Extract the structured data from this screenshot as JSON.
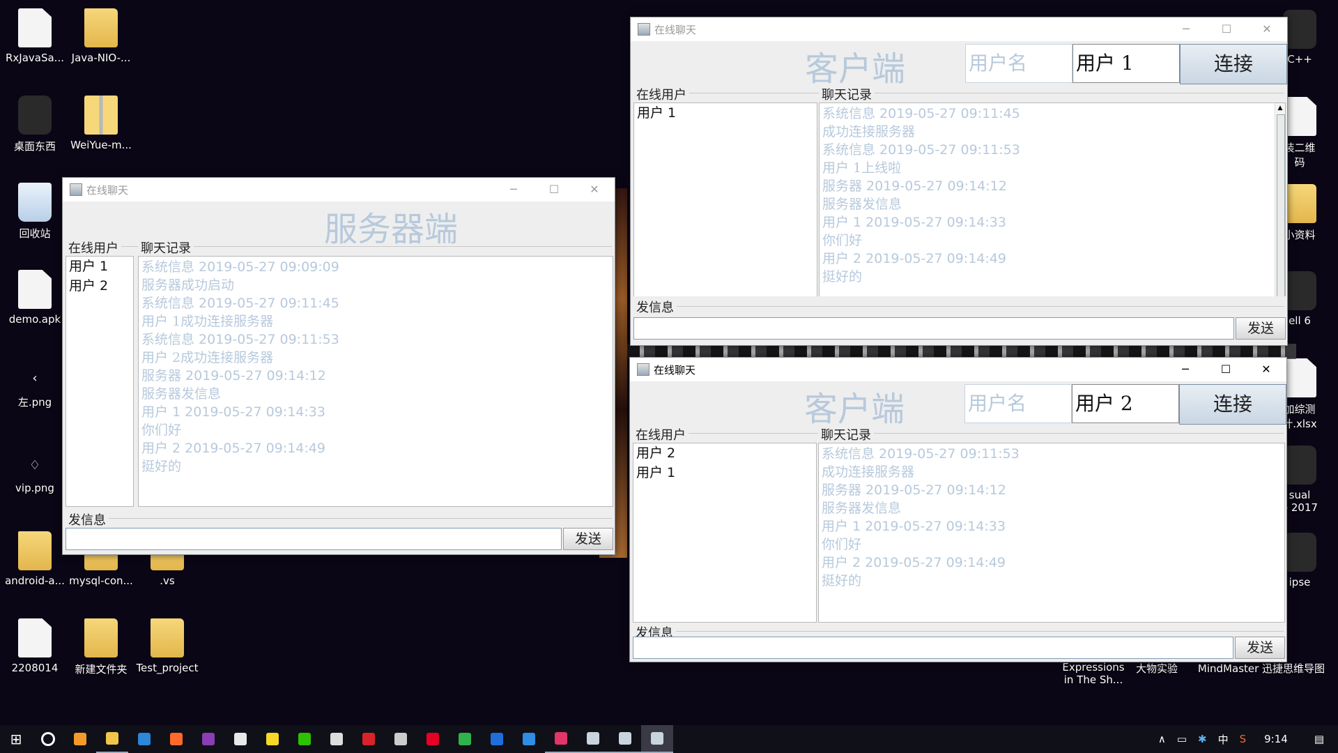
{
  "desktop": {
    "icons_left": [
      {
        "label": "RxJavaSa...",
        "type": "file"
      },
      {
        "label": "Java-NIO-...",
        "type": "folder"
      },
      {
        "label": "桌面东西",
        "type": "app"
      },
      {
        "label": "WeiYue-m...",
        "type": "zip"
      },
      {
        "label": "回收站",
        "type": "bin"
      },
      {
        "label": "demo.apk",
        "type": "file"
      },
      {
        "label": "左.png",
        "type": "small",
        "glyph": "‹"
      },
      {
        "label": "vip.png",
        "type": "small",
        "glyph": "♢"
      },
      {
        "label": "android-a...",
        "type": "folder"
      },
      {
        "label": "mysql-con...",
        "type": "folder"
      },
      {
        "label": ".vs",
        "type": "folder"
      },
      {
        "label": "2208014",
        "type": "file"
      },
      {
        "label": "新建文件夹",
        "type": "folder"
      },
      {
        "label": "Test_project",
        "type": "folder"
      }
    ],
    "icons_right": [
      {
        "label": "C++",
        "type": "app"
      },
      {
        "label": "装二维\n码",
        "type": "file"
      },
      {
        "label": "小资料",
        "type": "folder"
      },
      {
        "label": "ell 6",
        "type": "app"
      },
      {
        "label": "加综测\n计.xlsx",
        "type": "file"
      },
      {
        "label": "sual\no 2017",
        "type": "app"
      },
      {
        "label": "ipse",
        "type": "app"
      }
    ],
    "bottom_labels": [
      "Expressions\nin The Sh...",
      "大物实验",
      "MindMaster 迅捷思维导图"
    ]
  },
  "server_window": {
    "title": "在线聊天",
    "heading": "服务器端",
    "online_label": "在线用户",
    "chat_label": "聊天记录",
    "users": [
      "用户 1",
      "用户 2"
    ],
    "messages": [
      {
        "text": "系统信息   2019-05-27 09:09:09",
        "cn": false
      },
      {
        "text": "服务器成功启动",
        "cn": true
      },
      {
        "text": "系统信息   2019-05-27 09:11:45",
        "cn": false
      },
      {
        "text": "用户 1成功连接服务器",
        "cn": true
      },
      {
        "text": "系统信息   2019-05-27 09:11:53",
        "cn": false
      },
      {
        "text": "用户 2成功连接服务器",
        "cn": true
      },
      {
        "text": "服务器   2019-05-27 09:14:12",
        "cn": false
      },
      {
        "text": "服务器发信息",
        "cn": true
      },
      {
        "text": "用户 1   2019-05-27 09:14:33",
        "cn": false
      },
      {
        "text": "你们好",
        "cn": true
      },
      {
        "text": "用户 2   2019-05-27 09:14:49",
        "cn": false
      },
      {
        "text": "挺好的",
        "cn": true
      }
    ],
    "send_label": "发信息",
    "send_button": "发送",
    "input_value": ""
  },
  "client1_window": {
    "title": "在线聊天",
    "heading": "客户端",
    "username_placeholder": "用户名",
    "username_value": "用户  1",
    "connect_button": "连接",
    "online_label": "在线用户",
    "chat_label": "聊天记录",
    "users": [
      "用户 1"
    ],
    "messages": [
      {
        "text": "系统信息   2019-05-27 09:11:45",
        "cn": false
      },
      {
        "text": "成功连接服务器",
        "cn": true
      },
      {
        "text": "系统信息   2019-05-27 09:11:53",
        "cn": false
      },
      {
        "text": "用户 1上线啦",
        "cn": true
      },
      {
        "text": "服务器   2019-05-27 09:14:12",
        "cn": false
      },
      {
        "text": "服务器发信息",
        "cn": true
      },
      {
        "text": "用户 1   2019-05-27 09:14:33",
        "cn": false
      },
      {
        "text": "你们好",
        "cn": true
      },
      {
        "text": "用户 2   2019-05-27 09:14:49",
        "cn": false
      },
      {
        "text": "挺好的",
        "cn": true
      }
    ],
    "send_label": "发信息",
    "send_button": "发送",
    "input_value": ""
  },
  "client2_window": {
    "title": "在线聊天",
    "heading": "客户端",
    "username_placeholder": "用户名",
    "username_value": "用户  2",
    "connect_button": "连接",
    "online_label": "在线用户",
    "chat_label": "聊天记录",
    "users": [
      "用户 2",
      "用户 1"
    ],
    "messages": [
      {
        "text": "系统信息   2019-05-27 09:11:53",
        "cn": false
      },
      {
        "text": "成功连接服务器",
        "cn": true
      },
      {
        "text": "服务器   2019-05-27 09:14:12",
        "cn": false
      },
      {
        "text": "服务器发信息",
        "cn": true
      },
      {
        "text": "用户 1   2019-05-27 09:14:33",
        "cn": false
      },
      {
        "text": "你们好",
        "cn": true
      },
      {
        "text": "用户 2   2019-05-27 09:14:49",
        "cn": false
      },
      {
        "text": "挺好的",
        "cn": true
      }
    ],
    "send_label": "发信息",
    "send_button": "发送",
    "input_value": ""
  },
  "window_controls": {
    "minimize": "─",
    "maximize": "☐",
    "close": "✕"
  },
  "taskbar": {
    "start_icon": "windows-icon",
    "items": [
      {
        "name": "cortana-icon",
        "color": "#ffffff"
      },
      {
        "name": "app-orange-icon",
        "color": "#f39a2b"
      },
      {
        "name": "file-explorer-icon",
        "color": "#f0c64a"
      },
      {
        "name": "app-blue-star-icon",
        "color": "#2c86d9"
      },
      {
        "name": "firefox-icon",
        "color": "#ff6a2a"
      },
      {
        "name": "onenote-icon",
        "color": "#8a3db5"
      },
      {
        "name": "notepad-icon",
        "color": "#e8e8e8"
      },
      {
        "name": "sticky-notes-icon",
        "color": "#f7d826"
      },
      {
        "name": "wechat-icon",
        "color": "#2dc100"
      },
      {
        "name": "app-face-icon",
        "color": "#dddddd"
      },
      {
        "name": "youdao-icon",
        "color": "#d8232a"
      },
      {
        "name": "app-circle-icon",
        "color": "#cccccc"
      },
      {
        "name": "netease-music-icon",
        "color": "#e60026"
      },
      {
        "name": "media-player-icon",
        "color": "#2fb34a"
      },
      {
        "name": "app-blue-icon",
        "color": "#1e6fd9"
      },
      {
        "name": "edge-icon",
        "color": "#2f8de4"
      },
      {
        "name": "intellij-icon",
        "color": "#e2356a"
      },
      {
        "name": "java-window-1-icon",
        "color": "#c9d4df"
      },
      {
        "name": "java-window-2-icon",
        "color": "#c9d4df"
      },
      {
        "name": "java-window-3-icon",
        "color": "#c9d4df"
      }
    ],
    "tray": {
      "ime": "中",
      "time": "9:14"
    }
  }
}
